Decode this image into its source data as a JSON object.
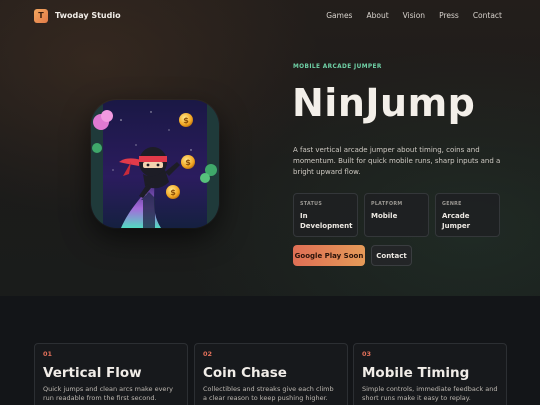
{
  "nav": {
    "logo_letter": "T",
    "brand": "Twoday Studio",
    "links": [
      "Games",
      "About",
      "Vision",
      "Press",
      "Contact"
    ]
  },
  "hero": {
    "eyebrow": "MOBILE ARCADE JUMPER",
    "title": "NinJump",
    "description": "A fast vertical arcade jumper about timing, coins and momentum. Built for quick mobile runs, sharp inputs and a bright upward flow.",
    "stats": [
      {
        "label": "STATUS",
        "value": "In Development"
      },
      {
        "label": "PLATFORM",
        "value": "Mobile"
      },
      {
        "label": "GENRE",
        "value": "Arcade Jumper"
      }
    ],
    "primary_button": "Google Play Soon",
    "secondary_button": "Contact"
  },
  "features": [
    {
      "num": "01",
      "title": "Vertical Flow",
      "text": "Quick jumps and clean arcs make every run readable from the first second."
    },
    {
      "num": "02",
      "title": "Coin Chase",
      "text": "Collectibles and streaks give each climb a clear reason to keep pushing higher."
    },
    {
      "num": "03",
      "title": "Mobile Timing",
      "text": "Simple controls, immediate feedback and short runs make it easy to replay."
    }
  ],
  "colors": {
    "accent_green": "#6fd1a6",
    "accent_orange": "#e59a58",
    "accent_red": "#e2705a",
    "background": "#141619"
  }
}
